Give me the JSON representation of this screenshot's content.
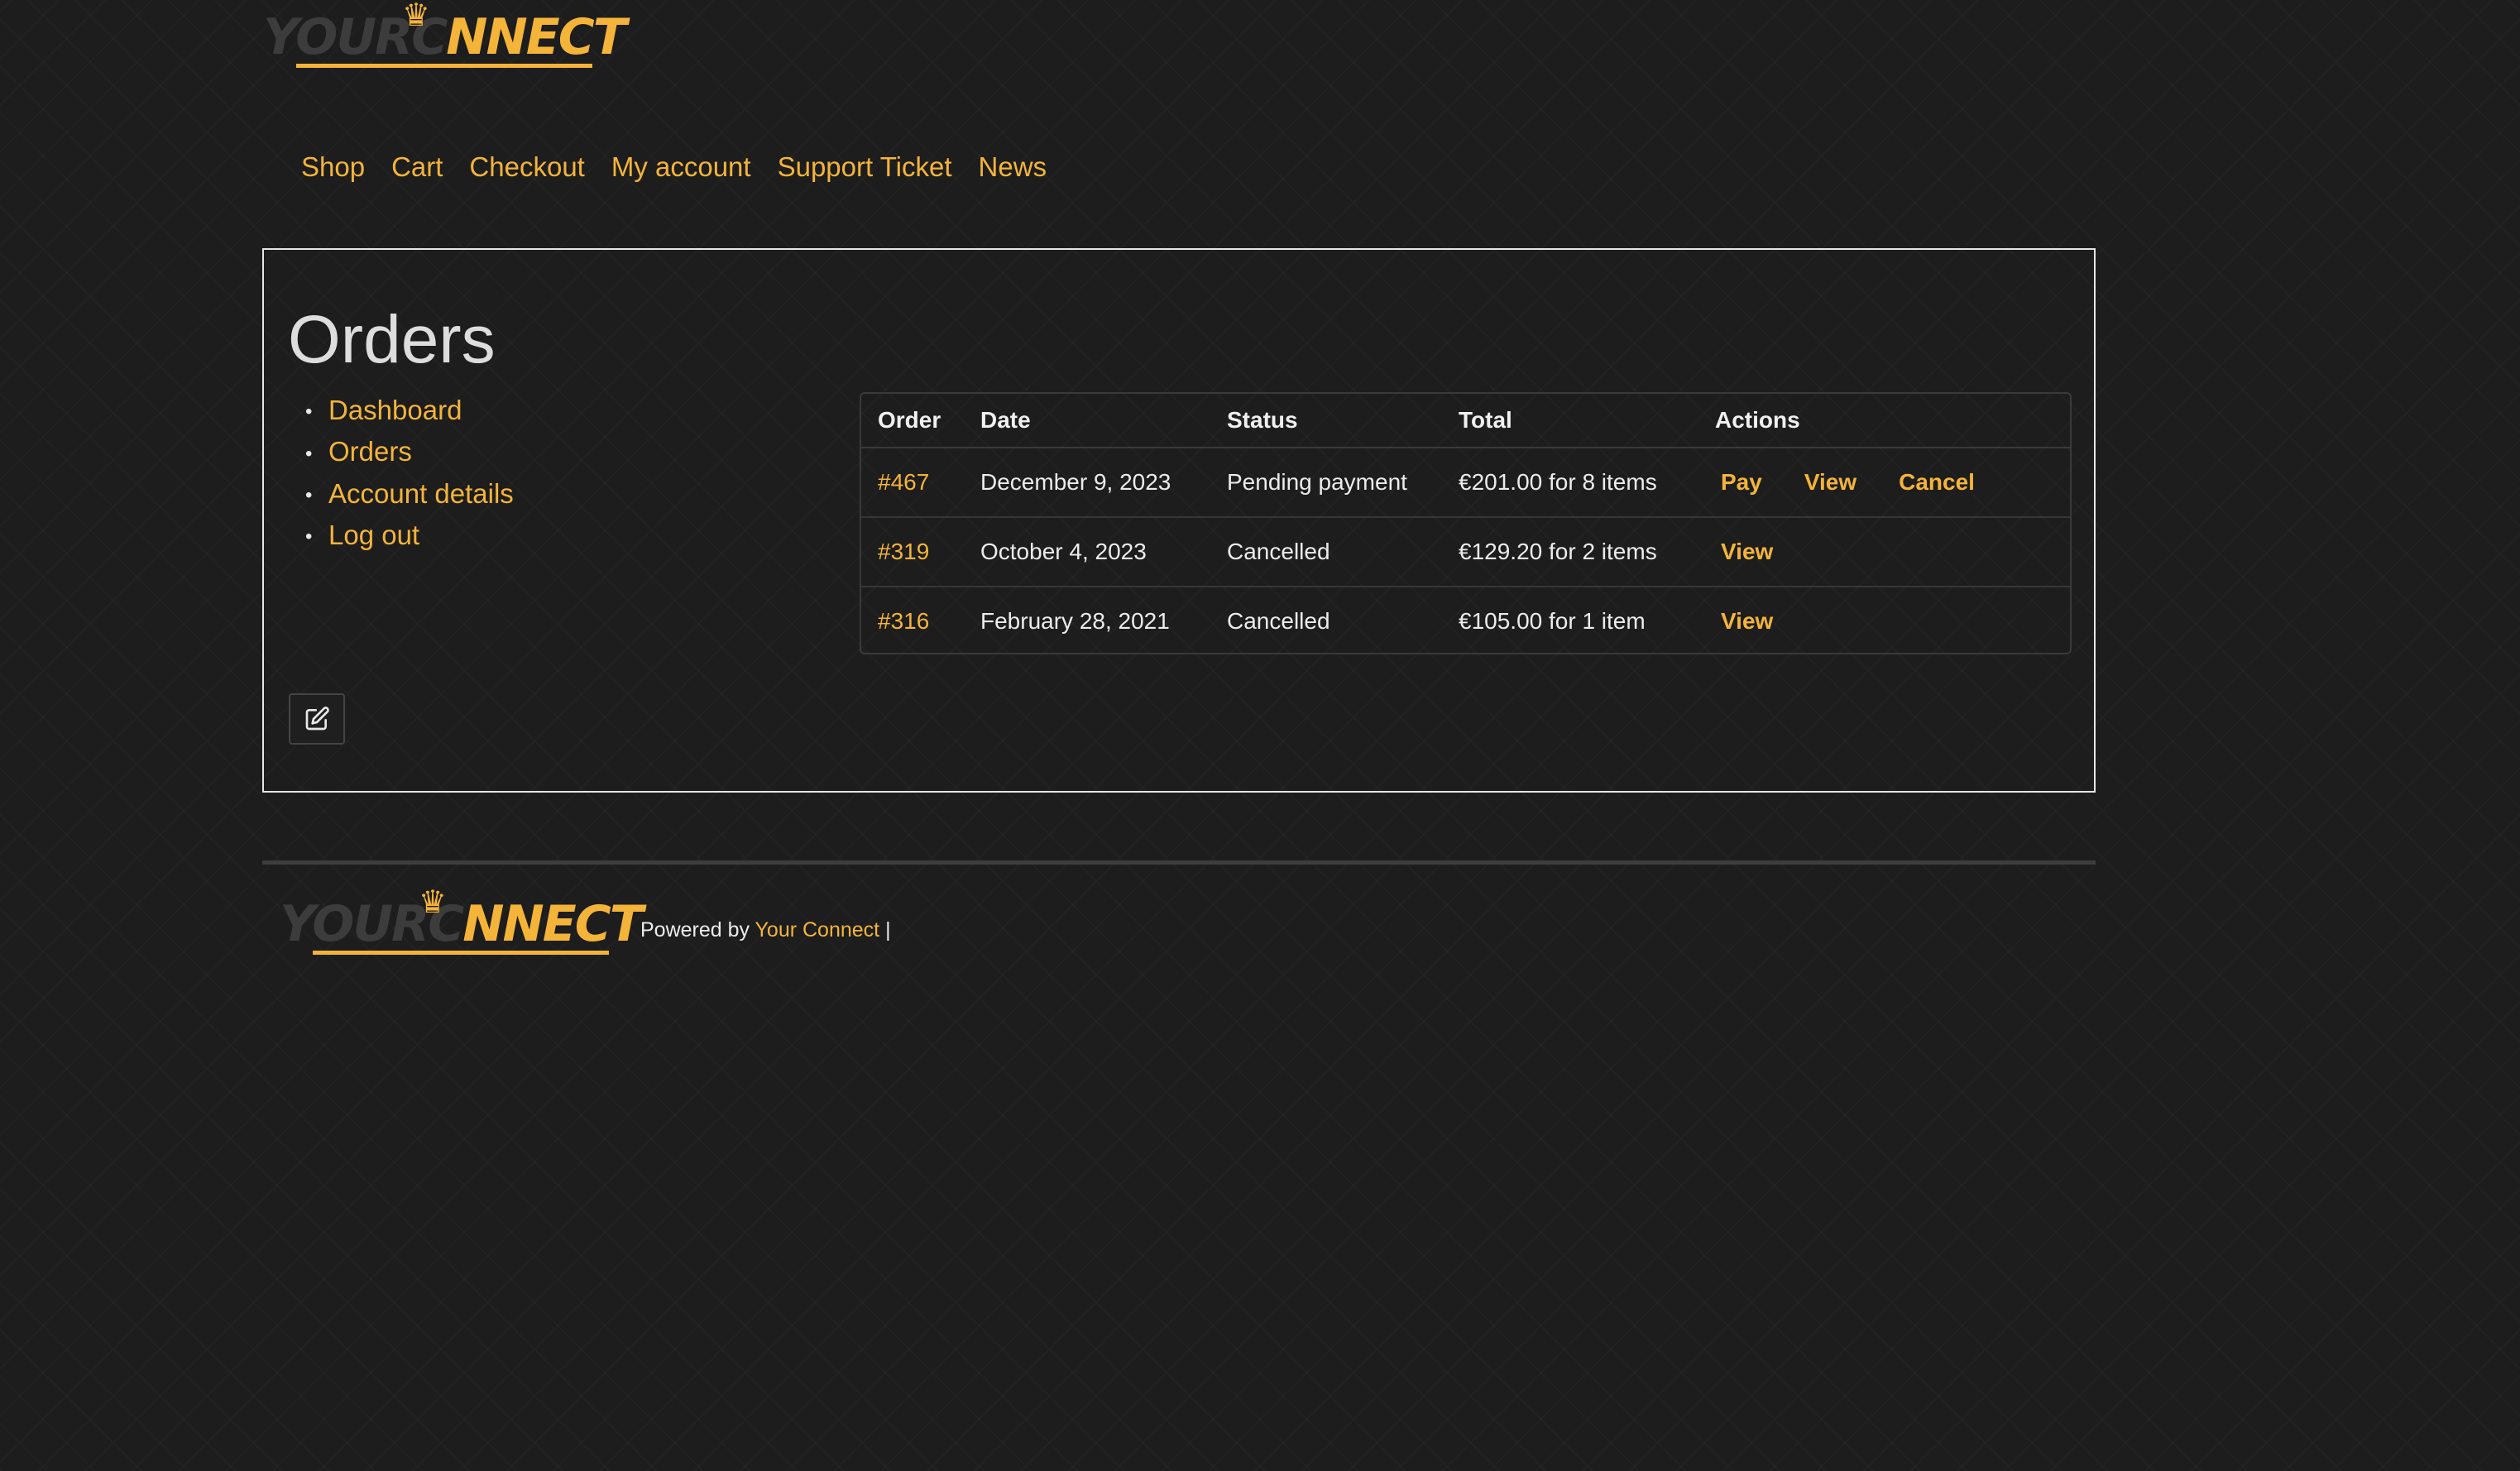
{
  "brand": {
    "logo_part1": "YOURC",
    "logo_part2": "NNECT",
    "crown_glyph": "♛",
    "accent_color": "#f4b43a"
  },
  "nav": {
    "items": [
      "Shop",
      "Cart",
      "Checkout",
      "My account",
      "Support Ticket",
      "News"
    ]
  },
  "page": {
    "title": "Orders"
  },
  "account_nav": {
    "items": [
      "Dashboard",
      "Orders",
      "Account details",
      "Log out"
    ]
  },
  "orders_table": {
    "headers": [
      "Order",
      "Date",
      "Status",
      "Total",
      "Actions"
    ],
    "rows": [
      {
        "order": "#467",
        "date": "December 9, 2023",
        "status": "Pending payment",
        "total": "€201.00 for 8 items",
        "actions": [
          "Pay",
          "View",
          "Cancel"
        ]
      },
      {
        "order": "#319",
        "date": "October 4, 2023",
        "status": "Cancelled",
        "total": "€129.20 for 2 items",
        "actions": [
          "View"
        ]
      },
      {
        "order": "#316",
        "date": "February 28, 2021",
        "status": "Cancelled",
        "total": "€105.00 for 1 item",
        "actions": [
          "View"
        ]
      }
    ]
  },
  "edit_icon": "edit-icon",
  "footer": {
    "powered_prefix": "Powered by",
    "powered_link": "Your Connect",
    "powered_suffix": "|"
  }
}
